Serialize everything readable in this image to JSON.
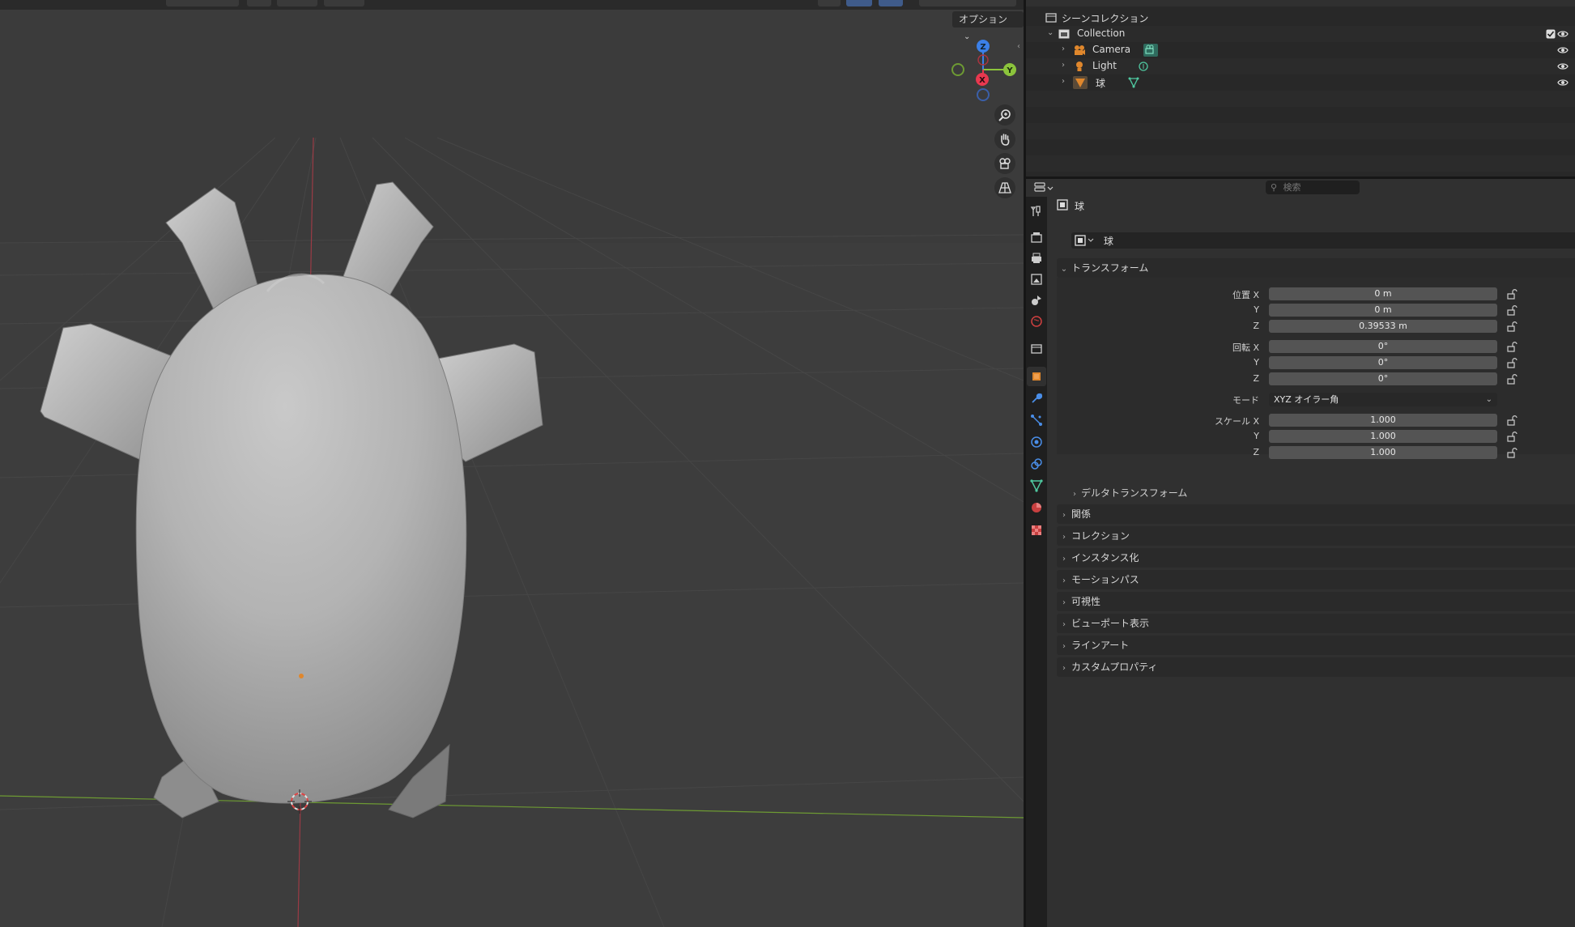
{
  "viewport": {
    "options_label": "オプション"
  },
  "outliner": {
    "scene_collection": "シーンコレクション",
    "collection": "Collection",
    "items": [
      {
        "label": "Camera",
        "icon": "camera-icon"
      },
      {
        "label": "Light",
        "icon": "light-icon"
      },
      {
        "label": "球",
        "icon": "mesh-icon"
      }
    ]
  },
  "properties": {
    "search_placeholder": "検索",
    "object_name": "球",
    "datablock_name": "球",
    "transform": {
      "title": "トランスフォーム",
      "location_label": "位置 X",
      "location": {
        "x": "0 m",
        "y": "0 m",
        "z": "0.39533 m"
      },
      "rotation_label": "回転 X",
      "rotation": {
        "x": "0°",
        "y": "0°",
        "z": "0°"
      },
      "mode_label": "モード",
      "mode_value": "XYZ オイラー角",
      "scale_label": "スケール X",
      "scale": {
        "x": "1.000",
        "y": "1.000",
        "z": "1.000"
      },
      "axis_y": "Y",
      "axis_z": "Z",
      "delta": "デルタトランスフォーム"
    },
    "panels": [
      "関係",
      "コレクション",
      "インスタンス化",
      "モーションパス",
      "可視性",
      "ビューポート表示",
      "ラインアート",
      "カスタムプロパティ"
    ]
  },
  "colors": {
    "axis_x": "#e8384f",
    "axis_y": "#8cc43c",
    "axis_z": "#3b80e8",
    "active_object": "#e0872c"
  }
}
